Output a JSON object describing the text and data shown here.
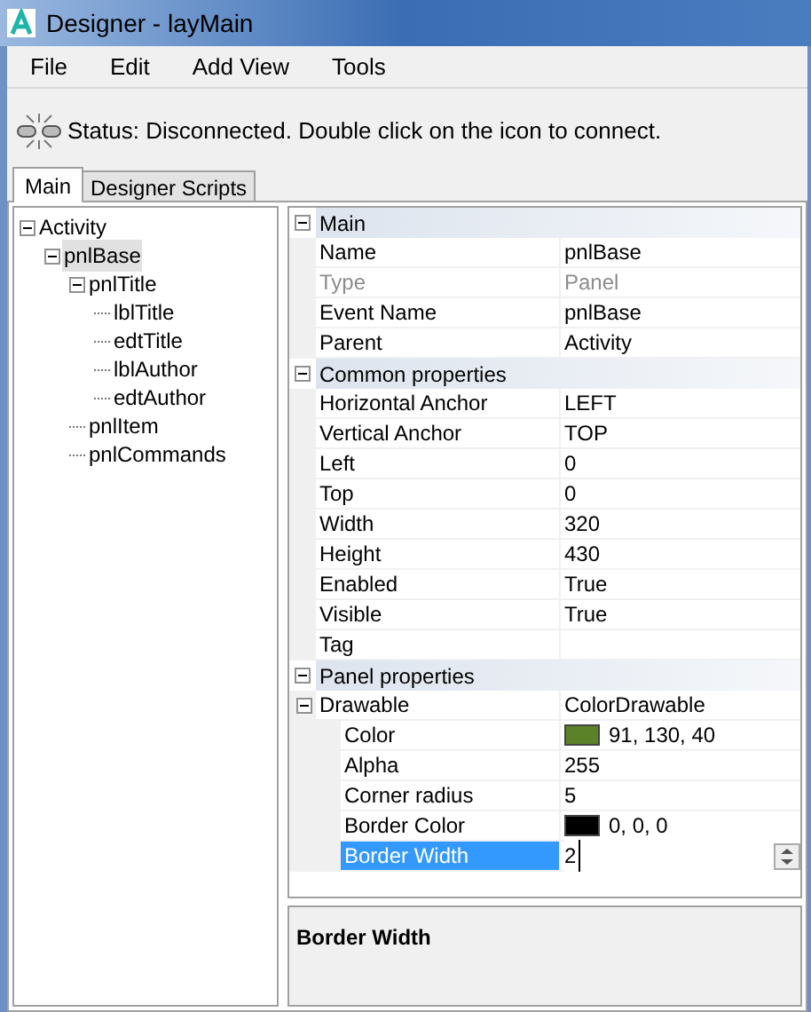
{
  "window": {
    "title": "Designer - layMain"
  },
  "menu": [
    "File",
    "Edit",
    "Add View",
    "Tools"
  ],
  "status": "Status: Disconnected. Double click on the icon to connect.",
  "tabs": [
    {
      "label": "Main",
      "selected": true
    },
    {
      "label": "Designer Scripts",
      "selected": false
    }
  ],
  "tree": [
    {
      "label": "Activity",
      "expanded": true,
      "selected": false,
      "children": [
        {
          "label": "pnlBase",
          "expanded": true,
          "selected": true,
          "children": [
            {
              "label": "pnlTitle",
              "expanded": true,
              "selected": false,
              "children": [
                {
                  "label": "lblTitle",
                  "selected": false
                },
                {
                  "label": "edtTitle",
                  "selected": false
                },
                {
                  "label": "lblAuthor",
                  "selected": false
                },
                {
                  "label": "edtAuthor",
                  "selected": false
                }
              ]
            },
            {
              "label": "pnlItem",
              "selected": false
            },
            {
              "label": "pnlCommands",
              "selected": false
            }
          ]
        }
      ]
    }
  ],
  "properties": [
    {
      "category": "Main",
      "expanded": true,
      "rows": [
        {
          "kind": "text",
          "name": "Name",
          "value": "pnlBase",
          "disabled": false,
          "selected": false
        },
        {
          "kind": "text",
          "name": "Type",
          "value": "Panel",
          "disabled": true,
          "selected": false
        },
        {
          "kind": "text",
          "name": "Event Name",
          "value": "pnlBase",
          "disabled": false,
          "selected": false
        },
        {
          "kind": "text",
          "name": "Parent",
          "value": "Activity",
          "disabled": false,
          "selected": false
        }
      ]
    },
    {
      "category": "Common properties",
      "expanded": true,
      "rows": [
        {
          "kind": "text",
          "name": "Horizontal Anchor",
          "value": "LEFT",
          "disabled": false,
          "selected": false
        },
        {
          "kind": "text",
          "name": "Vertical Anchor",
          "value": "TOP",
          "disabled": false,
          "selected": false
        },
        {
          "kind": "text",
          "name": "Left",
          "value": "0",
          "disabled": false,
          "selected": false
        },
        {
          "kind": "text",
          "name": "Top",
          "value": "0",
          "disabled": false,
          "selected": false
        },
        {
          "kind": "text",
          "name": "Width",
          "value": "320",
          "disabled": false,
          "selected": false
        },
        {
          "kind": "text",
          "name": "Height",
          "value": "430",
          "disabled": false,
          "selected": false
        },
        {
          "kind": "text",
          "name": "Enabled",
          "value": "True",
          "disabled": false,
          "selected": false
        },
        {
          "kind": "text",
          "name": "Visible",
          "value": "True",
          "disabled": false,
          "selected": false
        },
        {
          "kind": "empty",
          "name": "Tag",
          "disabled": false,
          "selected": false
        }
      ]
    },
    {
      "category": "Panel properties",
      "expanded": true,
      "rows": [
        {
          "kind": "group",
          "name": "Drawable",
          "value": "ColorDrawable",
          "expanded": true,
          "disabled": false,
          "selected": false,
          "children": [
            {
              "kind": "color",
              "name": "Color",
              "value": "91, 130, 40",
              "color": "#5b8228",
              "disabled": false,
              "selected": false
            },
            {
              "kind": "text",
              "name": "Alpha",
              "value": "255",
              "disabled": false,
              "selected": false
            },
            {
              "kind": "text",
              "name": "Corner radius",
              "value": "5",
              "disabled": false,
              "selected": false
            },
            {
              "kind": "color",
              "name": "Border Color",
              "value": "0, 0, 0",
              "color": "#000000",
              "disabled": false,
              "selected": false
            },
            {
              "kind": "spin",
              "name": "Border Width",
              "value": "2",
              "disabled": false,
              "selected": true
            }
          ]
        }
      ]
    }
  ],
  "description": {
    "title": "Border Width"
  }
}
